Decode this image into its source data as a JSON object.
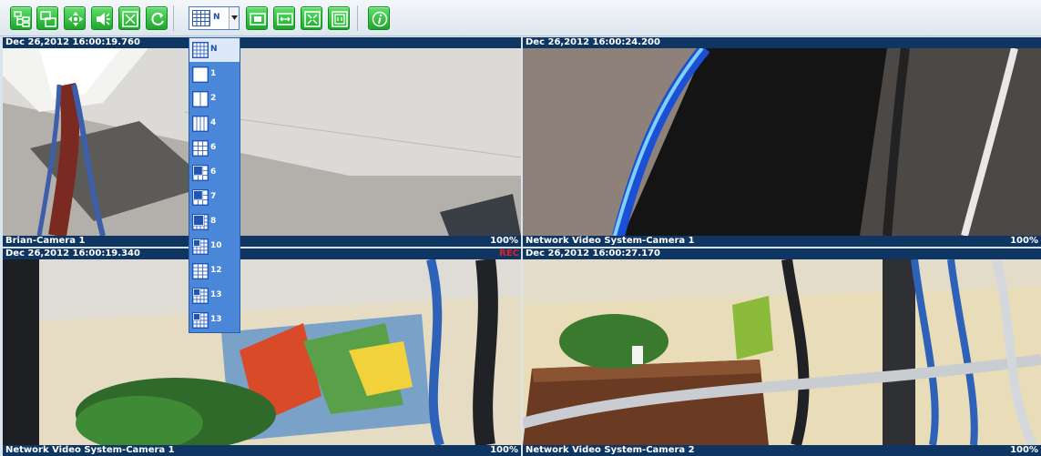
{
  "toolbar": {
    "buttons": [
      {
        "name": "tree-view-icon"
      },
      {
        "name": "windows-icon"
      },
      {
        "name": "ptz-icon"
      },
      {
        "name": "audio-icon"
      },
      {
        "name": "fullscreen-exit-icon"
      },
      {
        "name": "refresh-icon"
      },
      {
        "name": "fit-window-icon"
      },
      {
        "name": "stretch-icon"
      },
      {
        "name": "expand-icon"
      },
      {
        "name": "snapshot-icon"
      },
      {
        "name": "info-icon"
      }
    ],
    "layout_selected": "N"
  },
  "layout_menu": {
    "items": [
      "N",
      "1",
      "2",
      "4",
      "6",
      "6",
      "7",
      "8",
      "10",
      "12",
      "13",
      "13"
    ],
    "selected_index": 0
  },
  "cameras": [
    {
      "timestamp": "Dec 26,2012 16:00:19.760",
      "name": "Brian-Camera 1",
      "zoom": "100%",
      "rec": ""
    },
    {
      "timestamp": "Dec 26,2012 16:00:24.200",
      "name": "Network Video System-Camera 1",
      "zoom": "100%",
      "rec": ""
    },
    {
      "timestamp": "Dec 26,2012 16:00:19.340",
      "name": "Network Video System-Camera 1",
      "zoom": "100%",
      "rec": "REC"
    },
    {
      "timestamp": "Dec 26,2012 16:00:27.170",
      "name": "Network Video System-Camera 2",
      "zoom": "100%",
      "rec": ""
    }
  ],
  "colors": {
    "accent": "#1fa52c",
    "header_bar": "#0f3663",
    "menu_bg": "#4b87d9",
    "rec": "#e02020"
  }
}
